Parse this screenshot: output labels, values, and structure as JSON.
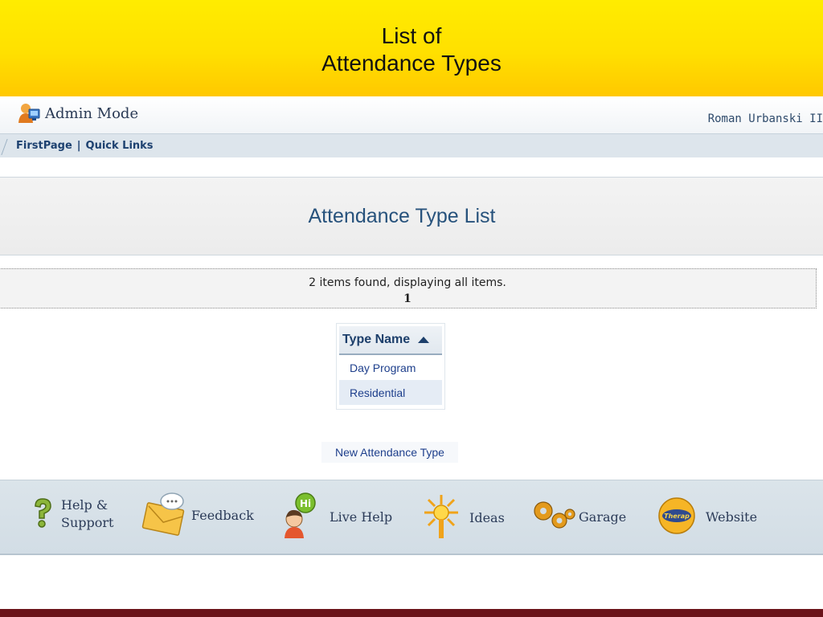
{
  "slide": {
    "title_line1": "List of",
    "title_line2": "Attendance Types"
  },
  "header": {
    "mode": "Admin Mode",
    "user": "Roman Urbanski II"
  },
  "nav": {
    "first_page": "FirstPage",
    "separator": "|",
    "quick_links": "Quick Links"
  },
  "main": {
    "title": "Attendance Type List",
    "items_found": "2 items found, displaying all items.",
    "page_number": "1",
    "table": {
      "column": "Type Name",
      "rows": [
        "Day Program",
        "Residential"
      ]
    },
    "new_link": "New Attendance Type"
  },
  "footer": {
    "items": [
      {
        "line1": "Help &",
        "line2": "Support",
        "icon": "question-mark-icon"
      },
      {
        "label": "Feedback",
        "icon": "envelope-icon"
      },
      {
        "label": "Live Help",
        "icon": "chat-person-icon"
      },
      {
        "label": "Ideas",
        "icon": "lightbulb-icon"
      },
      {
        "label": "Garage",
        "icon": "gears-icon"
      },
      {
        "label": "Website",
        "icon": "website-badge-icon",
        "badge_text": "Therap"
      }
    ]
  },
  "colors": {
    "banner": "#ffe000",
    "link": "#1e3f8c",
    "bottom_strip": "#6b1319"
  }
}
